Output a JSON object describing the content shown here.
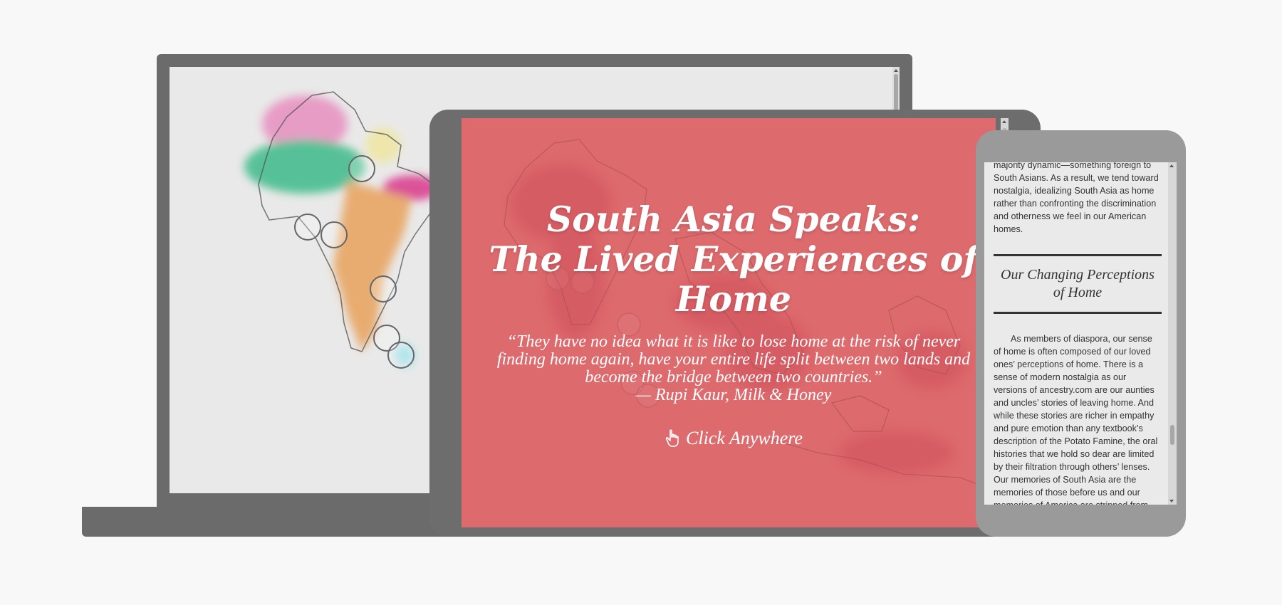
{
  "hero": {
    "title_line1": "South Asia Speaks:",
    "title_line2": "The Lived Experiences of",
    "title_line3": "Home",
    "quote": "“They have no idea what it is like to lose home at the risk of never finding home again, have your entire life split between two lands and become the bridge between two countries.”",
    "attribution": "— Rupi Kaur, Milk & Honey",
    "cta_label": "Click Anywhere",
    "cta_icon": "pointing-hand-icon"
  },
  "phone": {
    "paragraph_top": "majority dynamic—something foreign to South Asians. As a result, we tend toward nostalgia, idealizing South Asia as home rather than confronting the discrimination and otherness we feel in our American homes.",
    "section_heading": "Our Changing Perceptions of Home",
    "paragraph_body": "As members of diaspora, our sense of home is often composed of our loved ones’ perceptions of home. There is a sense of modern nostalgia as our versions of ancestry.com are our aunties and uncles’ stories of leaving home. And while these stories are richer in empathy and pure emotion than any textbook’s description of the Potato Famine, the oral histories that we hold so dear are limited by their filtration through others’ lenses. Our memories of South Asia are the memories of those before us and our memories of America are stripped from"
  },
  "colors": {
    "background": "#f8f8f8",
    "device_frame": "#6b6b6b",
    "phone_frame": "#9a9a9a",
    "hero_overlay": "#dd6a6d",
    "map_pink": "#e78fc0",
    "map_green": "#3dbb8a",
    "map_orange": "#e8a25c",
    "map_yellow": "#efe6a2",
    "map_magenta": "#d9378a",
    "map_cyan": "#8fdbe6"
  }
}
